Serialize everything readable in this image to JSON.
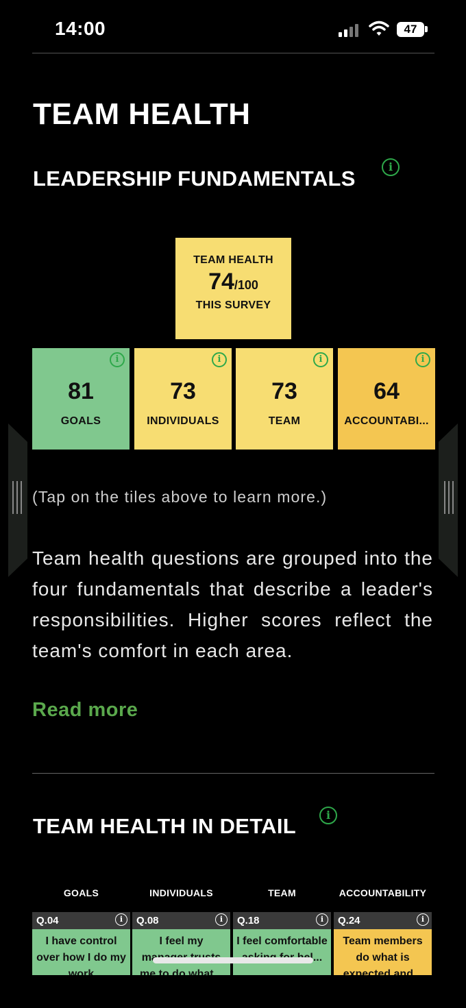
{
  "status_bar": {
    "time": "14:00",
    "battery": "47"
  },
  "page_title": "TEAM HEALTH",
  "fundamentals": {
    "title": "LEADERSHIP FUNDAMENTALS",
    "summary": {
      "label_top": "TEAM HEALTH",
      "score": "74",
      "denominator": "/100",
      "label_bottom": "THIS SURVEY",
      "color": "#f7dd72"
    },
    "tiles": [
      {
        "score": "81",
        "name": "GOALS",
        "color": "#80c88e"
      },
      {
        "score": "73",
        "name": "INDIVIDUALS",
        "color": "#f7dd72"
      },
      {
        "score": "73",
        "name": "TEAM",
        "color": "#f7dd72"
      },
      {
        "score": "64",
        "name": "ACCOUNTABI...",
        "color": "#f4c651"
      }
    ],
    "hint": "(Tap on the tiles above to learn more.)",
    "description": "Team health questions are grouped into the four fundamentals that describe a leader's responsibilities. Higher scores reflect the team's comfort in each area.",
    "read_more": "Read more"
  },
  "detail": {
    "title": "TEAM HEALTH IN DETAIL",
    "columns": [
      "GOALS",
      "INDIVIDUALS",
      "TEAM",
      "ACCOUNTABILITY"
    ],
    "questions": [
      {
        "id": "Q.04",
        "text": "I have control over how I do my work",
        "color": "#80c88e"
      },
      {
        "id": "Q.08",
        "text": "I feel my manager trusts me to do what...",
        "color": "#80c88e"
      },
      {
        "id": "Q.18",
        "text": "I feel comfortable asking for hel...",
        "color": "#80c88e"
      },
      {
        "id": "Q.24",
        "text": "Team members do what is expected and...",
        "color": "#f4c651"
      }
    ]
  },
  "colors": {
    "accent_green": "#2ea84a",
    "link_green": "#5aa84c",
    "background": "#000000"
  }
}
